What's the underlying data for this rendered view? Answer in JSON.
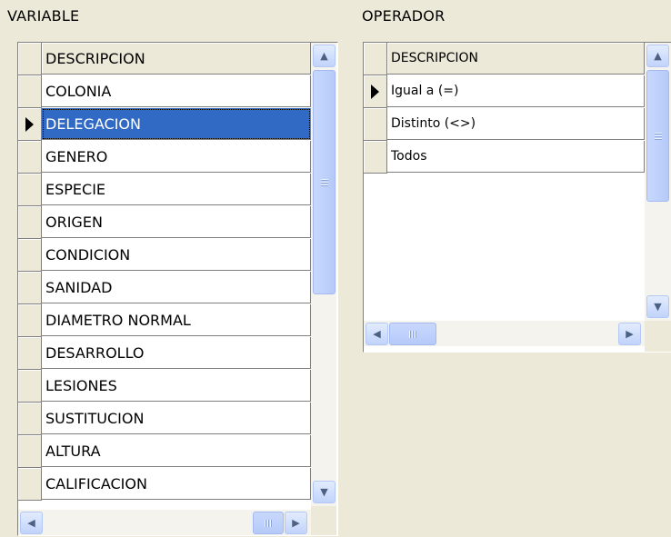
{
  "variable": {
    "label": "VARIABLE",
    "header": "DESCRIPCION",
    "rows": [
      "COLONIA",
      "DELEGACION",
      "GENERO",
      "ESPECIE",
      "ORIGEN",
      "CONDICION",
      "SANIDAD",
      "DIAMETRO NORMAL",
      "DESARROLLO",
      "LESIONES",
      "SUSTITUCION",
      "ALTURA",
      "CALIFICACION"
    ],
    "selected": "DELEGACION"
  },
  "operador": {
    "label": "OPERADOR",
    "header": "DESCRIPCION",
    "rows": [
      "Igual a (=)",
      "Distinto (<>)",
      "Todos"
    ],
    "current": "Igual a (=)"
  },
  "icons": {
    "up": "scroll-up-icon",
    "down": "scroll-down-icon",
    "left": "scroll-left-icon",
    "right": "scroll-right-icon",
    "row_pointer": "row-pointer-icon"
  },
  "colors": {
    "selection": "#316ac5",
    "form_bg": "#ece9d8"
  }
}
